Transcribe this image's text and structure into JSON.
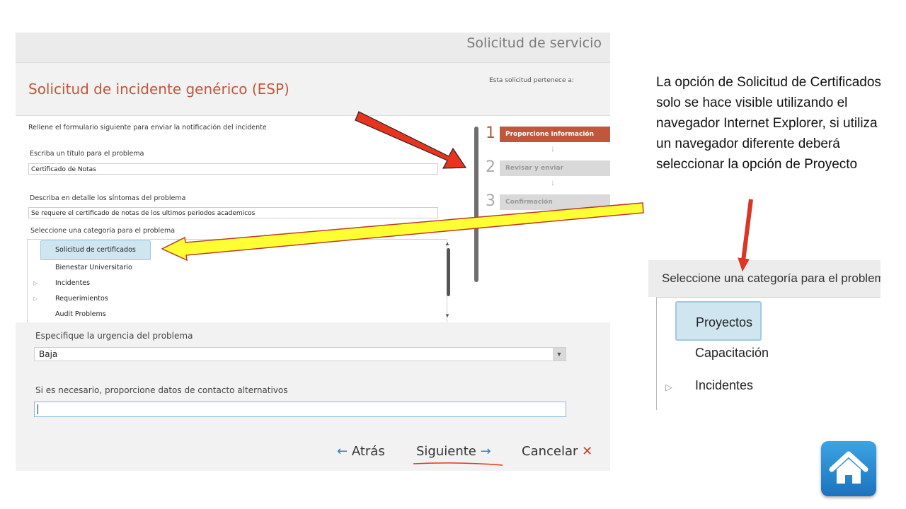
{
  "panel": {
    "service_title": "Solicitud de servicio",
    "form_title": "Solicitud de incidente genérico (ESP)",
    "belongs_label": "Esta solicitud pertenece a:",
    "intro": "Rellene el formulario siguiente para enviar la notificación del incidente",
    "title_label": "Escriba un título para el problema",
    "title_value": "Certificado de Notas",
    "symptoms_label": "Describa en detalle los síntomas del problema",
    "symptoms_value": "Se requere el certificado de notas de los ultimos periodos academicos",
    "category_label": "Seleccione una categoría para el problema",
    "categories": [
      {
        "label": "Solicitud de certificados",
        "selected": true,
        "expandable": false
      },
      {
        "label": "Bienestar Universitario",
        "selected": false,
        "expandable": false
      },
      {
        "label": "Incidentes",
        "selected": false,
        "expandable": true
      },
      {
        "label": "Requerimientos",
        "selected": false,
        "expandable": true
      },
      {
        "label": "Audit Problems",
        "selected": false,
        "expandable": false
      }
    ],
    "urgency_label": "Especifique la urgencia del problema",
    "urgency_value": "Baja",
    "contact_label": "Si es necesario, proporcione datos de contacto alternativos",
    "contact_value": "",
    "nav": {
      "back": "Atrás",
      "next": "Siguiente",
      "cancel": "Cancelar"
    },
    "steps": [
      {
        "number": "1",
        "label": "Proporcione información",
        "active": true
      },
      {
        "number": "2",
        "label": "Revisar y enviar",
        "active": false
      },
      {
        "number": "3",
        "label": "Confirmación",
        "active": false
      }
    ]
  },
  "note": "La opción de Solicitud de Certificados solo se hace visible utilizando el navegador Internet Explorer, si utiliza un navegador diferente deberá seleccionar la opción de Proyecto",
  "inset": {
    "header": "Seleccione una categoría para el problema",
    "items": [
      {
        "label": "Proyectos",
        "selected": true,
        "expandable": false
      },
      {
        "label": "Capacitación",
        "selected": false,
        "expandable": false
      },
      {
        "label": "Incidentes",
        "selected": false,
        "expandable": true
      }
    ]
  },
  "colors": {
    "accent": "#c0573a",
    "link_blue": "#2c86c1",
    "selection_bg": "#cfe6f1",
    "cancel_red": "#d23a2a",
    "arrow_red": "#e8331e",
    "arrow_yellow": "#ffff33",
    "home_blue": "#1c73bd"
  },
  "icons": {
    "back": "arrow-left-icon",
    "next": "arrow-right-icon",
    "cancel": "close-icon",
    "home": "home-icon"
  }
}
